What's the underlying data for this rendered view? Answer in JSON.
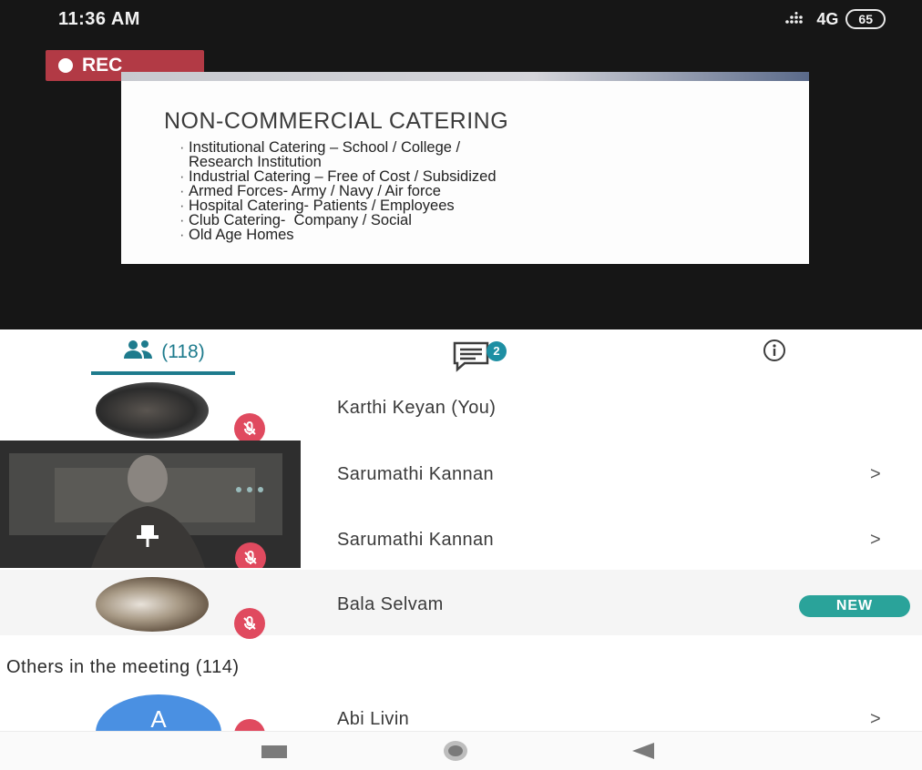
{
  "status_bar": {
    "time": "11:36 AM",
    "network": "4G",
    "battery": "65"
  },
  "recording": {
    "label": "REC"
  },
  "slide": {
    "title": "NON-COMMERCIAL CATERING",
    "lines": [
      "Institutional Catering – School / College /",
      "Research Institution",
      "Industrial Catering – Free of Cost / Subsidized",
      "Armed Forces- Army / Navy / Air force",
      "Hospital Catering- Patients / Employees",
      "Club Catering-  Company / Social",
      "Old Age Homes"
    ]
  },
  "tabs": {
    "participants_count": "(118)",
    "chat_badge": "2"
  },
  "participants": [
    {
      "name": "Karthi Keyan (You)"
    },
    {
      "name": "Sarumathi Kannan",
      "chevron": ">"
    },
    {
      "name": "Sarumathi Kannan",
      "chevron": ">"
    },
    {
      "name": "Bala Selvam",
      "badge": "NEW"
    }
  ],
  "others": {
    "header": "Others in the meeting (114)",
    "items": [
      {
        "name": "Abi Livin",
        "avatar_letter": "A",
        "chevron": ">"
      }
    ]
  },
  "colors": {
    "accent": "#1e7b8d",
    "rec": "#b23a45",
    "mute": "#e04a5f",
    "new_badge": "#2aa39a",
    "avatar_blue": "#4a90e2"
  },
  "icons": [
    "signal-icon",
    "people-icon",
    "chat-icon",
    "info-icon",
    "microphone-off-icon",
    "pin-icon",
    "nav-square-icon",
    "nav-circle-icon",
    "nav-back-icon"
  ]
}
